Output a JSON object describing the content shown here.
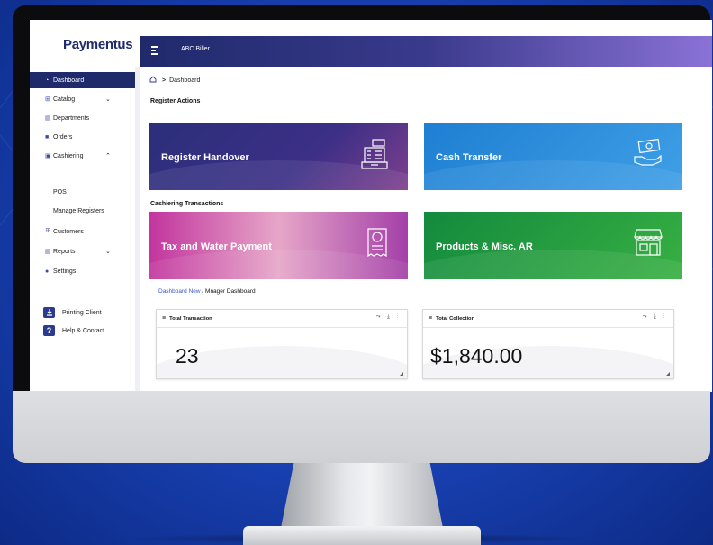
{
  "app": {
    "logo": "Paymentus",
    "biller": "ABC Biller"
  },
  "sidebar": {
    "items": [
      {
        "label": "Dashboard",
        "icon": "dashboard-icon",
        "glyph": "◔",
        "chevron": ""
      },
      {
        "label": "Catalog",
        "icon": "grid-icon",
        "glyph": "⊞",
        "chevron": "⌄"
      },
      {
        "label": "Departments",
        "icon": "building-icon",
        "glyph": "▤",
        "chevron": ""
      },
      {
        "label": "Orders",
        "icon": "orders-icon",
        "glyph": "■",
        "chevron": ""
      },
      {
        "label": "Cashiering",
        "icon": "cashier-icon",
        "glyph": "▣",
        "chevron": "⌃"
      },
      {
        "label": "Customers",
        "icon": "customers-icon",
        "glyph": "ꕥ",
        "chevron": ""
      },
      {
        "label": "Reports",
        "icon": "reports-icon",
        "glyph": "▤",
        "chevron": "⌄"
      },
      {
        "label": "Settings",
        "icon": "gear-icon",
        "glyph": "●",
        "chevron": ""
      }
    ],
    "sub_items": [
      "POS",
      "Manage Registers"
    ],
    "printing_client": "Printing Client",
    "help": "Help & Contact",
    "help_glyph": "?"
  },
  "breadcrumb": {
    "current": "Dashboard",
    "separator": ">"
  },
  "sections": {
    "register_actions": "Register Actions",
    "cashiering_transactions": "Cashiering Transactions"
  },
  "cards": [
    {
      "title": "Register Handover",
      "icon": "cash-register-icon"
    },
    {
      "title": "Cash Transfer",
      "icon": "money-hand-icon"
    },
    {
      "title": "Tax and Water Payment",
      "icon": "receipt-icon"
    },
    {
      "title": "Products & Misc. AR",
      "icon": "store-icon"
    }
  ],
  "dashboard_crumb": {
    "link": "Dashboard New",
    "separator": " / ",
    "current": "Mnager Dashboard"
  },
  "widgets": [
    {
      "title": "Total Transaction",
      "value": "23"
    },
    {
      "title": "Total Collection",
      "value": "$1,840.00"
    }
  ],
  "widget_tools": "⤳ ⤓ ⋮",
  "colors": {
    "brand_navy": "#1f2a6b",
    "accent_purple": "#8a72d6"
  }
}
